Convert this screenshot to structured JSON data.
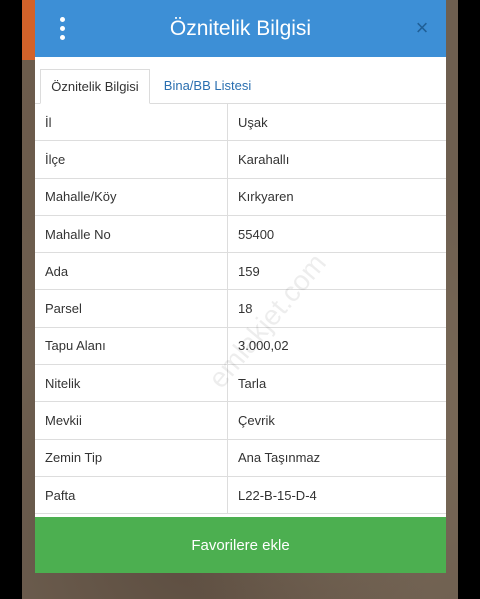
{
  "modal": {
    "title": "Öznitelik Bilgisi",
    "close_symbol": "×",
    "menu_icon": "vertical-dots-icon",
    "close_icon": "close-icon"
  },
  "tabs": [
    {
      "label": "Öznitelik Bilgisi",
      "active": true
    },
    {
      "label": "Bina/BB Listesi",
      "active": false
    }
  ],
  "rows": [
    {
      "key": "İl",
      "value": "Uşak"
    },
    {
      "key": "İlçe",
      "value": "Karahallı"
    },
    {
      "key": "Mahalle/Köy",
      "value": "Kırkyaren"
    },
    {
      "key": "Mahalle No",
      "value": "55400"
    },
    {
      "key": "Ada",
      "value": "159"
    },
    {
      "key": "Parsel",
      "value": "18"
    },
    {
      "key": "Tapu Alanı",
      "value": "3.000,02"
    },
    {
      "key": "Nitelik",
      "value": "Tarla"
    },
    {
      "key": "Mevkii",
      "value": "Çevrik"
    },
    {
      "key": "Zemin Tip",
      "value": "Ana Taşınmaz"
    },
    {
      "key": "Pafta",
      "value": "L22-B-15-D-4"
    }
  ],
  "footer": {
    "button_label": "Favorilere ekle"
  },
  "watermark": "emlakjet.com",
  "colors": {
    "header": "#3d8fd6",
    "footer_button": "#4caf50",
    "tab_link": "#2a6fb0"
  }
}
